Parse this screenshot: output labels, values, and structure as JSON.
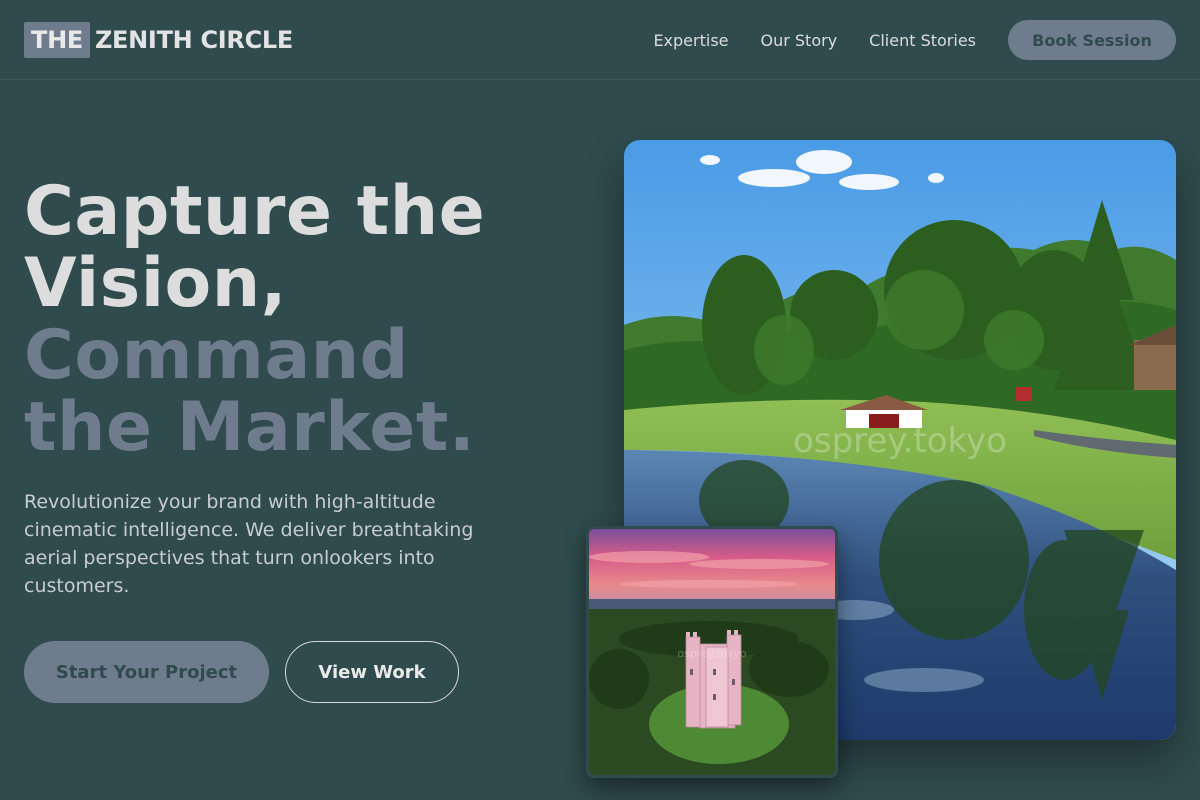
{
  "brand": {
    "logo_box": "THE",
    "logo_text": "ZENITH CIRCLE"
  },
  "nav": {
    "items": [
      {
        "label": "Expertise"
      },
      {
        "label": "Our Story"
      },
      {
        "label": "Client Stories"
      }
    ],
    "cta": "Book Session"
  },
  "hero": {
    "title_line1": "Capture the",
    "title_line2": "Vision,",
    "title_line3": "Command",
    "title_line4": "the Market.",
    "description": "Revolutionize your brand with high-altitude cinematic intelligence. We deliver breathtaking aerial perspectives that turn onlookers into customers.",
    "primary_button": "Start Your Project",
    "secondary_button": "View Work"
  },
  "images": {
    "main_watermark": "osprey.tokyo",
    "inset_watermark": "osprey.tokyo"
  },
  "colors": {
    "background": "#2f4b4d",
    "accent": "#6f7c8e",
    "heading_light": "#dddddd"
  }
}
